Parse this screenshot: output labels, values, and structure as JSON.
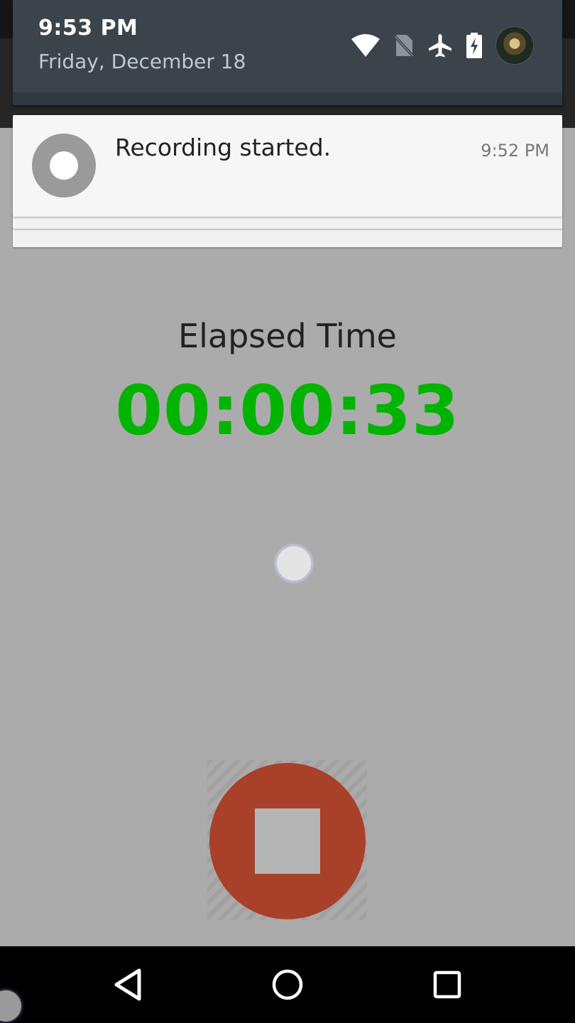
{
  "status_bar": {
    "time": "9:53 PM",
    "date": "Friday, December 18",
    "icons": [
      "wifi-icon",
      "no-sim-icon",
      "airplane-mode-icon",
      "battery-charging-icon",
      "user-avatar"
    ]
  },
  "notification": {
    "title": "Recording started.",
    "time": "9:52 PM",
    "icon": "record-icon"
  },
  "main": {
    "elapsed_label": "Elapsed Time",
    "elapsed_value": "00:00:33",
    "elapsed_color": "#00b400",
    "stop_button_color": "#a8402a"
  },
  "nav_bar": {
    "buttons": [
      "back-icon",
      "home-icon",
      "recents-icon"
    ]
  }
}
